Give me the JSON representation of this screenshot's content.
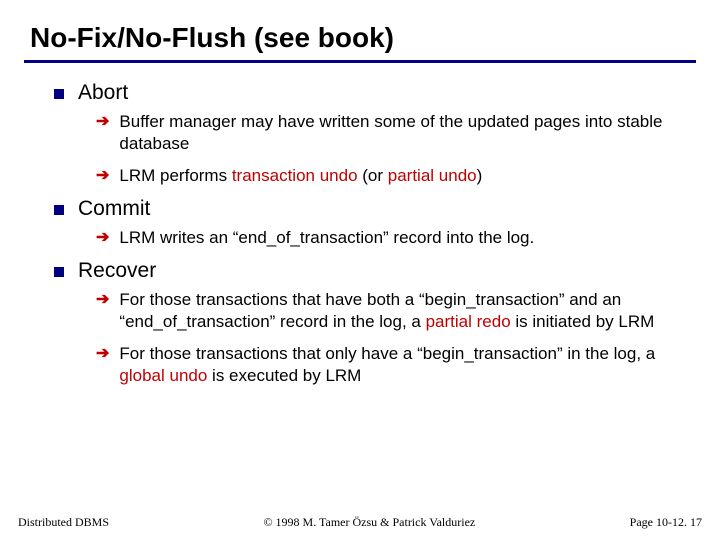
{
  "title": "No-Fix/No-Flush (see book)",
  "sections": [
    {
      "heading": "Abort",
      "items": [
        {
          "html": "Buffer manager may have written some of the updated pages into stable database"
        },
        {
          "html": "LRM  performs <span class=\"red\">transaction undo</span> (or <span class=\"red\">partial undo</span>)"
        }
      ]
    },
    {
      "heading": "Commit",
      "items": [
        {
          "html": "LRM writes an “end_of_transaction” record into the log."
        }
      ]
    },
    {
      "heading": "Recover",
      "items": [
        {
          "html": "For those transactions that have both a “begin_transaction” and an “end_of_transaction” record in the log, a <span class=\"red\">partial redo</span> is initiated by LRM"
        },
        {
          "html": "For those transactions that only have a “begin_transaction” in the log, a <span class=\"red\">global undo</span> is executed by LRM"
        }
      ]
    }
  ],
  "footer": {
    "left": "Distributed DBMS",
    "center": "© 1998 M. Tamer Özsu & Patrick Valduriez",
    "right": "Page 10-12. 17"
  }
}
